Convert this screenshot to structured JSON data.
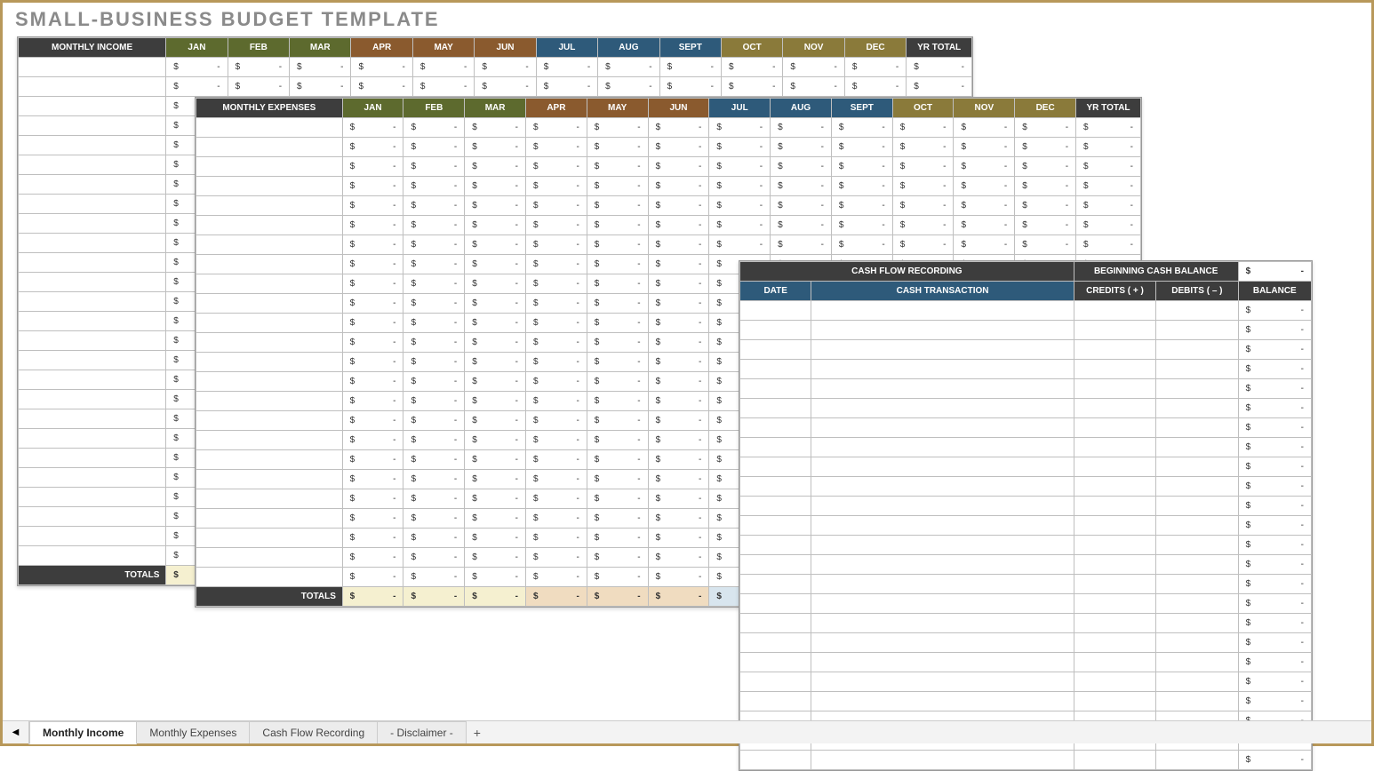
{
  "title": "SMALL-BUSINESS BUDGET TEMPLATE",
  "months": [
    "JAN",
    "FEB",
    "MAR",
    "APR",
    "MAY",
    "JUN",
    "JUL",
    "AUG",
    "SEPT",
    "OCT",
    "NOV",
    "DEC"
  ],
  "income": {
    "label": "MONTHLY INCOME",
    "yr_total": "YR TOTAL",
    "totals_label": "TOTALS",
    "currency": "$",
    "empty": "-",
    "row_count": 26
  },
  "expenses": {
    "label": "MONTHLY EXPENSES",
    "yr_total": "YR TOTAL",
    "totals_label": "TOTALS",
    "currency": "$",
    "empty": "-",
    "row_count": 24
  },
  "cashflow": {
    "title": "CASH FLOW RECORDING",
    "beginning_label": "BEGINNING CASH BALANCE",
    "date_label": "DATE",
    "transaction_label": "CASH TRANSACTION",
    "credits_label": "CREDITS ( + )",
    "debits_label": "DEBITS ( – )",
    "balance_label": "BALANCE",
    "currency": "$",
    "empty": "-",
    "row_count": 24
  },
  "tabs": {
    "items": [
      "Monthly Income",
      "Monthly Expenses",
      "Cash Flow Recording",
      "- Disclaimer -"
    ],
    "active_index": 0,
    "add": "+",
    "prev": "◀"
  }
}
